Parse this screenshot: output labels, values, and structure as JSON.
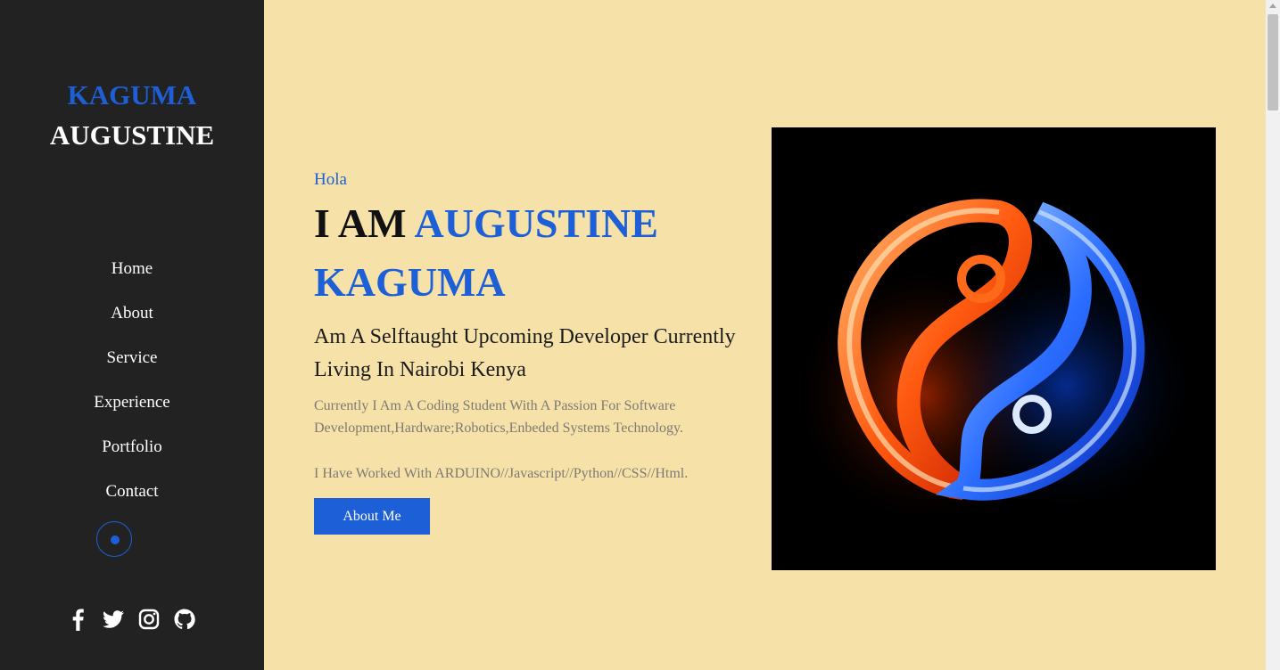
{
  "sidebar": {
    "brand_first": "KAGUMA",
    "brand_last": "AUGUSTINE",
    "nav": [
      "Home",
      "About",
      "Service",
      "Experience",
      "Portfolio",
      "Contact"
    ],
    "socials": [
      "facebook-icon",
      "twitter-icon",
      "instagram-icon",
      "github-icon"
    ]
  },
  "hero": {
    "greeting": "Hola",
    "headline_prefix": "I AM ",
    "headline_name": "AUGUSTINE KAGUMA",
    "tagline": "Am A Selftaught Upcoming Developer Currently Living In Nairobi Kenya",
    "description": "Currently I Am A Coding Student With A Passion For Software Development,Hardware;Robotics,Enbeded Systems Technology.",
    "skills": "I Have Worked With ARDUINO//Javascript//Python//CSS//Html.",
    "button_label": "About Me"
  },
  "colors": {
    "accent": "#1d5fd6",
    "sidebar_bg": "#222222",
    "page_bg": "#f6e2a8"
  }
}
